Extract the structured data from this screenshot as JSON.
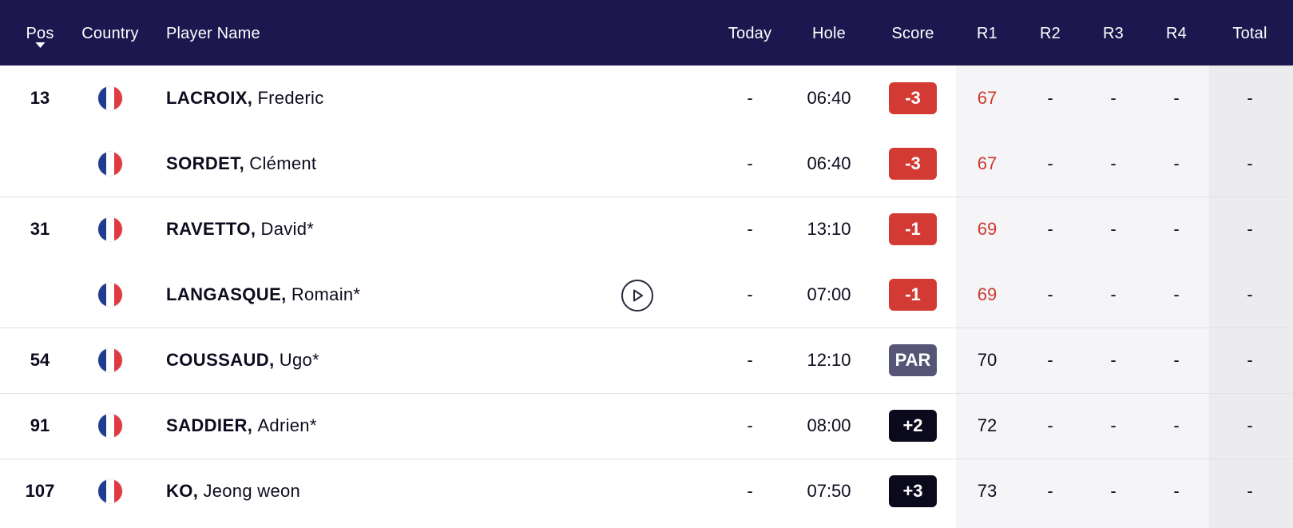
{
  "colors": {
    "header_bg": "#1d1750",
    "under_par_badge": "#d43a34",
    "par_badge": "#565575",
    "over_par_badge": "#0a0a1c",
    "under_par_round_text": "#cc3a33",
    "even_round_text": "#0c0c1e"
  },
  "header": {
    "pos": "Pos",
    "country": "Country",
    "player_name": "Player Name",
    "today": "Today",
    "hole": "Hole",
    "score": "Score",
    "r1": "R1",
    "r2": "R2",
    "r3": "R3",
    "r4": "R4",
    "total": "Total",
    "sort_icon": "caret-down-icon"
  },
  "players": [
    {
      "pos": "13",
      "country": "France",
      "flag_icon": "france-flag-icon",
      "last": "LACROIX,",
      "first": "Frederic",
      "today": "-",
      "hole": "06:40",
      "score": "-3",
      "score_type": "under",
      "r1": "67",
      "r2": "-",
      "r3": "-",
      "r4": "-",
      "total": "-"
    },
    {
      "pos": "",
      "country": "France",
      "flag_icon": "france-flag-icon",
      "last": "SORDET,",
      "first": "Clément",
      "today": "-",
      "hole": "06:40",
      "score": "-3",
      "score_type": "under",
      "r1": "67",
      "r2": "-",
      "r3": "-",
      "r4": "-",
      "total": "-"
    },
    {
      "pos": "31",
      "country": "France",
      "flag_icon": "france-flag-icon",
      "last": "RAVETTO,",
      "first": "David*",
      "today": "-",
      "hole": "13:10",
      "score": "-1",
      "score_type": "under",
      "r1": "69",
      "r2": "-",
      "r3": "-",
      "r4": "-",
      "total": "-"
    },
    {
      "pos": "",
      "country": "France",
      "flag_icon": "france-flag-icon",
      "last": "LANGASQUE,",
      "first": "Romain*",
      "today": "-",
      "hole": "07:00",
      "score": "-1",
      "score_type": "under",
      "r1": "69",
      "r2": "-",
      "r3": "-",
      "r4": "-",
      "total": "-",
      "video_icon": "play-icon"
    },
    {
      "pos": "54",
      "country": "France",
      "flag_icon": "france-flag-icon",
      "last": "COUSSAUD,",
      "first": "Ugo*",
      "today": "-",
      "hole": "12:10",
      "score": "PAR",
      "score_type": "par",
      "r1": "70",
      "r2": "-",
      "r3": "-",
      "r4": "-",
      "total": "-"
    },
    {
      "pos": "91",
      "country": "France",
      "flag_icon": "france-flag-icon",
      "last": "SADDIER,",
      "first": "Adrien*",
      "today": "-",
      "hole": "08:00",
      "score": "+2",
      "score_type": "over",
      "r1": "72",
      "r2": "-",
      "r3": "-",
      "r4": "-",
      "total": "-"
    },
    {
      "pos": "107",
      "country": "France",
      "flag_icon": "france-flag-icon",
      "last": "KO,",
      "first": "Jeong weon",
      "today": "-",
      "hole": "07:50",
      "score": "+3",
      "score_type": "over",
      "r1": "73",
      "r2": "-",
      "r3": "-",
      "r4": "-",
      "total": "-"
    }
  ]
}
